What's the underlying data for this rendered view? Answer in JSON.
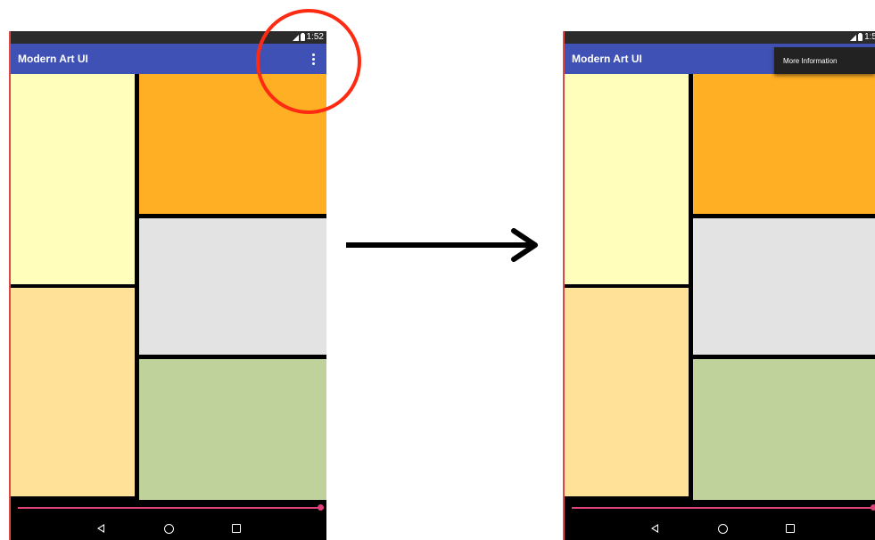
{
  "app": {
    "title": "Modern Art UI"
  },
  "statusbar": {
    "time": "1:52",
    "time_right": "1:5"
  },
  "menu": {
    "overflow_icon": "more-vert-icon",
    "items": [
      "More Information"
    ]
  },
  "colors": {
    "app_bar": "#3f51b5",
    "status_bar": "#2b2b2b",
    "highlight": "#ff2a12",
    "slider": "#e0407a",
    "block_yellow": "#ffffbb",
    "block_orange": "#ffaf23",
    "block_peach": "#ffe198",
    "block_gray": "#e3e3e3",
    "block_green": "#bfd29b"
  },
  "navigation": {
    "icons": [
      "back-icon",
      "home-icon",
      "recents-icon"
    ]
  }
}
